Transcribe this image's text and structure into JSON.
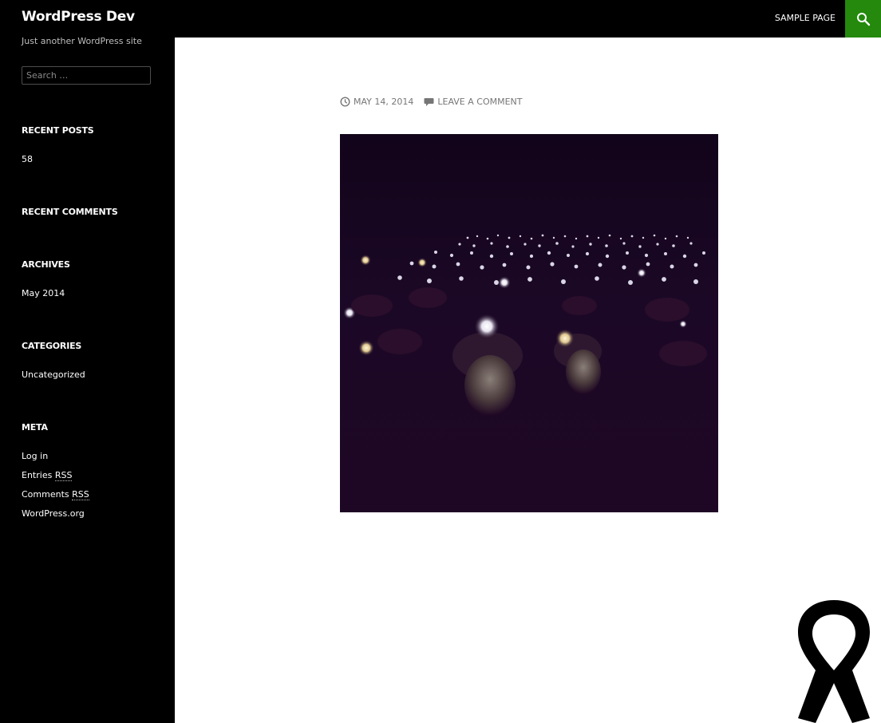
{
  "site": {
    "title": "WordPress Dev",
    "tagline": "Just another WordPress site"
  },
  "nav": {
    "sample_page": "SAMPLE PAGE",
    "search_icon": "search-icon"
  },
  "search": {
    "placeholder": "Search …"
  },
  "widgets": {
    "recent_posts": {
      "title": "RECENT POSTS",
      "items": [
        "58"
      ]
    },
    "recent_comments": {
      "title": "RECENT COMMENTS"
    },
    "archives": {
      "title": "ARCHIVES",
      "items": [
        "May 2014"
      ]
    },
    "categories": {
      "title": "CATEGORIES",
      "items": [
        "Uncategorized"
      ]
    },
    "meta": {
      "title": "META",
      "login": "Log in",
      "entries_prefix": "Entries ",
      "comments_prefix": "Comments ",
      "rss": "RSS",
      "wordpress_org": "WordPress.org"
    }
  },
  "post": {
    "date": "MAY 14, 2014",
    "leave_comment": "LEAVE A COMMENT",
    "date_icon": "clock-icon",
    "comment_icon": "comment-bubble-icon"
  },
  "colors": {
    "accent": "#24890d",
    "sidebar_bg": "#000000",
    "meta_text": "#767676"
  }
}
